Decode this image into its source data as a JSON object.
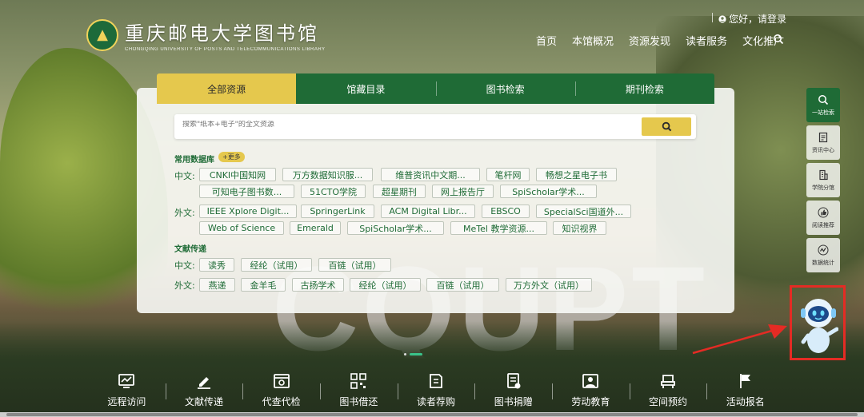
{
  "header": {
    "library_name": "重庆邮电大学图书馆",
    "library_name_en": "CHONGQING UNIVERSITY OF POSTS AND TELECOMMUNICATIONS LIBRARY",
    "login_text": "您好，请登录",
    "nav": [
      "首页",
      "本馆概况",
      "资源发现",
      "读者服务",
      "文化推广"
    ]
  },
  "search": {
    "tabs": [
      "全部资源",
      "馆藏目录",
      "图书检索",
      "期刊检索"
    ],
    "active_tab": "全部资源",
    "placeholder": "搜索\"纸本+电子\"的全文资源"
  },
  "databases": {
    "title": "常用数据库",
    "more": "+更多",
    "cn_label": "中文:",
    "cn_row1": [
      "CNKI中国知网",
      "万方数据知识服...",
      "维普资讯中文期...",
      "笔杆网",
      "畅想之星电子书"
    ],
    "cn_row2": [
      "可知电子图书数...",
      "51CTO学院",
      "超星期刊",
      "网上报告厅",
      "SpiScholar学术..."
    ],
    "en_label": "外文:",
    "en_row1": [
      "IEEE Xplore Digit...",
      "SpringerLink",
      "ACM Digital Libr...",
      "EBSCO",
      "SpecialSci国道外..."
    ],
    "en_row2": [
      "Web of Science",
      "Emerald",
      "SpiScholar学术...",
      "MeTel 教学资源...",
      "知识视界"
    ]
  },
  "delivery": {
    "title": "文献传递",
    "cn_label": "中文:",
    "cn": [
      "读秀",
      "经纶（试用）",
      "百链（试用）"
    ],
    "en_label": "外文:",
    "en": [
      "燕递",
      "金羊毛",
      "古扬学术",
      "经纶（试用）",
      "百链（试用）",
      "万方外文（试用）"
    ]
  },
  "sidebar": [
    "一站检索",
    "资讯中心",
    "学院分馆",
    "阅读推荐",
    "数据统计"
  ],
  "bottom": [
    "远程访问",
    "文献传递",
    "代查代检",
    "图书借还",
    "读者荐购",
    "图书捐赠",
    "劳动教育",
    "空间预约",
    "活动报名"
  ],
  "colors": {
    "primary": "#1f6b36",
    "accent": "#e5c84d",
    "highlight": "#e42b24"
  }
}
